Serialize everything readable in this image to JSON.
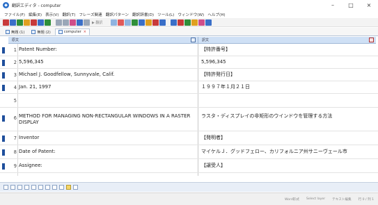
{
  "window": {
    "title": "翻訳エディタ - computer",
    "app_icon": "app-logo-icon",
    "minimize": "–",
    "maximize": "□",
    "close": "×"
  },
  "menu": [
    "ファイル(F)",
    "編集(E)",
    "表示(V)",
    "翻訳(T)",
    "フレーズ関連",
    "翻訳パターン",
    "翻訳辞書(D)",
    "ツール(L)",
    "ウィンドウ(W)",
    "ヘルプ(H)"
  ],
  "toolbar": {
    "text_label": "▶ 翻訳"
  },
  "tabs": [
    {
      "label": "無題 (1)",
      "active": false
    },
    {
      "label": "無題 (2)",
      "active": false
    },
    {
      "label": "computer",
      "active": true
    }
  ],
  "panes": {
    "source_header": "原文",
    "target_header": "訳文"
  },
  "rows": [
    {
      "num": "1",
      "source": "Patent Number:",
      "target": "【特許番号】"
    },
    {
      "num": "2",
      "source": "5,596,345",
      "target": "5,596,345"
    },
    {
      "num": "3",
      "source": "Michael J. Goodfellow, Sunnyvale, Calif.",
      "target": "【特許発行日】"
    },
    {
      "num": "4",
      "source": "Jan. 21, 1997",
      "target": "１９９７年１月２１日"
    },
    {
      "num": "5",
      "source": "",
      "target": ""
    },
    {
      "num": "6",
      "source": "METHOD FOR MANAGING NON-RECTANGULAR WINDOWS IN A RASTER DISPLAY",
      "target": "ラスタ・ディスプレイの非矩形のウインドウを管理する方法"
    },
    {
      "num": "7",
      "source": "Inventor",
      "target": "【発明者】"
    },
    {
      "num": "8",
      "source": "Date of Patent:",
      "target": "マイケルＪ．グッドフェロー、カリフォルニア州サニーヴェール市"
    },
    {
      "num": "9",
      "source": "Assignee:",
      "target": "【譲受人】"
    }
  ],
  "colors": {
    "row_marker": "#1f4f9c",
    "pane_header": "#cfe0f5",
    "active_bottom_button": "#f5d66b"
  },
  "status": {
    "mode": "Word形式",
    "segment": "Select layer",
    "edit": "テキスト編集",
    "counts": "行 0 / 列 1"
  }
}
